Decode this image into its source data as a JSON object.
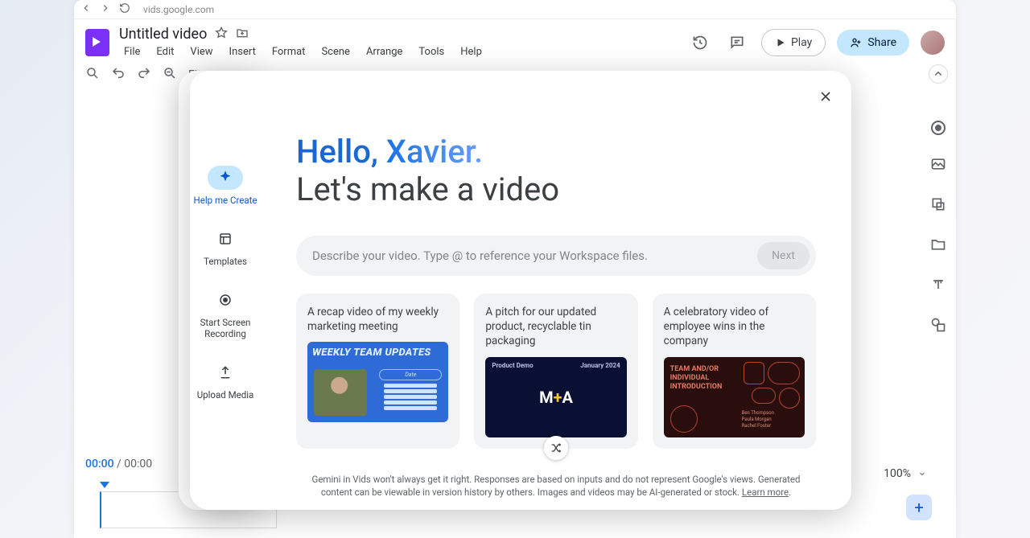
{
  "browser": {
    "url": "vids.google.com"
  },
  "doc": {
    "title": "Untitled video"
  },
  "menu": {
    "file": "File",
    "edit": "Edit",
    "view": "View",
    "insert": "Insert",
    "format": "Format",
    "scene": "Scene",
    "arrange": "Arrange",
    "tools": "Tools",
    "help": "Help"
  },
  "header": {
    "play": "Play",
    "share": "Share"
  },
  "toolbar": {
    "fit": "Fit"
  },
  "timeline": {
    "current": "00:00",
    "total": "00:00",
    "zoom": "100%"
  },
  "modal": {
    "side": {
      "help": "Help me Create",
      "templates": "Templates",
      "record": "Start Screen Recording",
      "upload": "Upload Media"
    },
    "greeting_hello": "Hello, ",
    "greeting_name": "Xavier.",
    "greeting_line2": "Let's make a video",
    "prompt_placeholder": "Describe your video. Type @ to reference your Workspace files.",
    "next": "Next",
    "card1": "A recap video of my weekly marketing meeting",
    "card2": "A pitch for our updated product, recyclable tin packaging",
    "card3": "A celebratory video of employee wins in the company",
    "thumb1_date": "Date",
    "disclaimer": "Gemini in Vids won't always get it right. Responses are based on inputs and do not represent Google's views. Generated content can be viewable in version history by others. Images and videos may be AI-generated or stock. ",
    "learn_more": "Learn more"
  }
}
